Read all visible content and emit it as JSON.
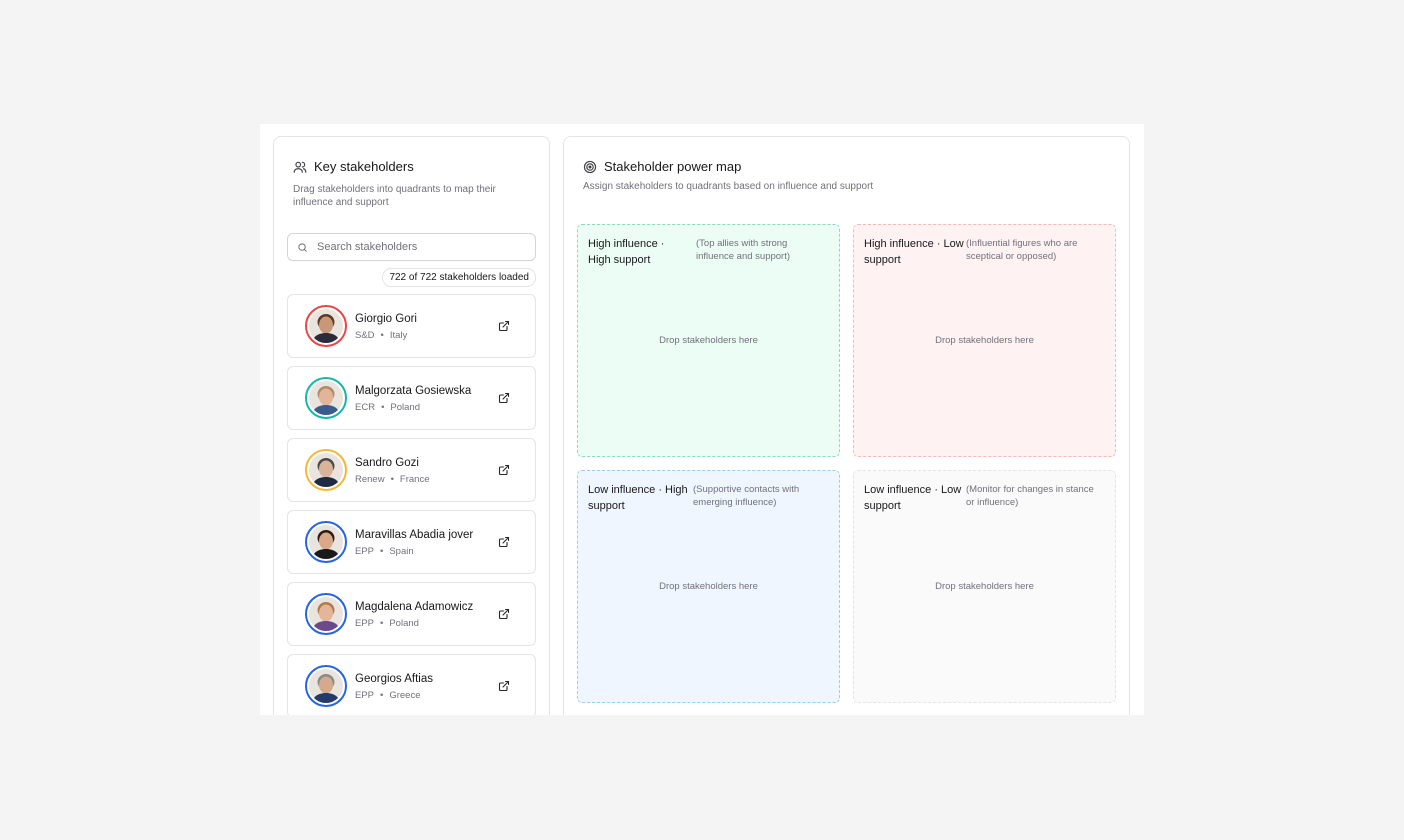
{
  "stakeholders_panel": {
    "title": "Key stakeholders",
    "description": "Drag stakeholders into quadrants to map their influence and support",
    "search_placeholder": "Search stakeholders",
    "loaded_count": "722 of 722 stakeholders loaded",
    "items": [
      {
        "name": "Giorgio Gori",
        "group": "S&D",
        "country": "Italy",
        "ring_color": "#ef4444",
        "skin": "#c89878",
        "hair": "#5a3a25",
        "shirt": "#2b2b3a"
      },
      {
        "name": "Malgorzata Gosiewska",
        "group": "ECR",
        "country": "Poland",
        "ring_color": "#14b8a6",
        "skin": "#e2b49a",
        "hair": "#b08a6a",
        "shirt": "#3b5b8a"
      },
      {
        "name": "Sandro Gozi",
        "group": "Renew",
        "country": "France",
        "ring_color": "#f5b73b",
        "skin": "#d9b39a",
        "hair": "#4a4a4a",
        "shirt": "#1f2a44"
      },
      {
        "name": "Maravillas Abadia jover",
        "group": "EPP",
        "country": "Spain",
        "ring_color": "#2563eb",
        "skin": "#d8a888",
        "hair": "#2a1c15",
        "shirt": "#1a1a1a"
      },
      {
        "name": "Magdalena Adamowicz",
        "group": "EPP",
        "country": "Poland",
        "ring_color": "#2563eb",
        "skin": "#e3b59a",
        "hair": "#b27a4a",
        "shirt": "#6a4a8a"
      },
      {
        "name": "Georgios Aftias",
        "group": "EPP",
        "country": "Greece",
        "ring_color": "#2563eb",
        "skin": "#d4a98c",
        "hair": "#8a8a8a",
        "shirt": "#243a6a"
      }
    ]
  },
  "power_map": {
    "title": "Stakeholder power map",
    "description": "Assign stakeholders to quadrants based on influence and support",
    "quadrants": {
      "high_high": {
        "title": "High influence · High support",
        "note": "(Top allies with strong influence and support)",
        "drop": "Drop stakeholders here"
      },
      "high_low": {
        "title": "High influence · Low support",
        "note": "(Influential figures who are sceptical or opposed)",
        "drop": "Drop stakeholders here"
      },
      "low_high": {
        "title": "Low influence · High support",
        "note": "(Supportive contacts with emerging influence)",
        "drop": "Drop stakeholders here"
      },
      "low_low": {
        "title": "Low influence · Low support",
        "note": "(Monitor for changes in stance or influence)",
        "drop": "Drop stakeholders here"
      }
    }
  },
  "icons": {
    "stakeholders": "users-icon",
    "power_map": "target-icon",
    "search": "search-icon",
    "open_profile": "external-link-icon"
  }
}
